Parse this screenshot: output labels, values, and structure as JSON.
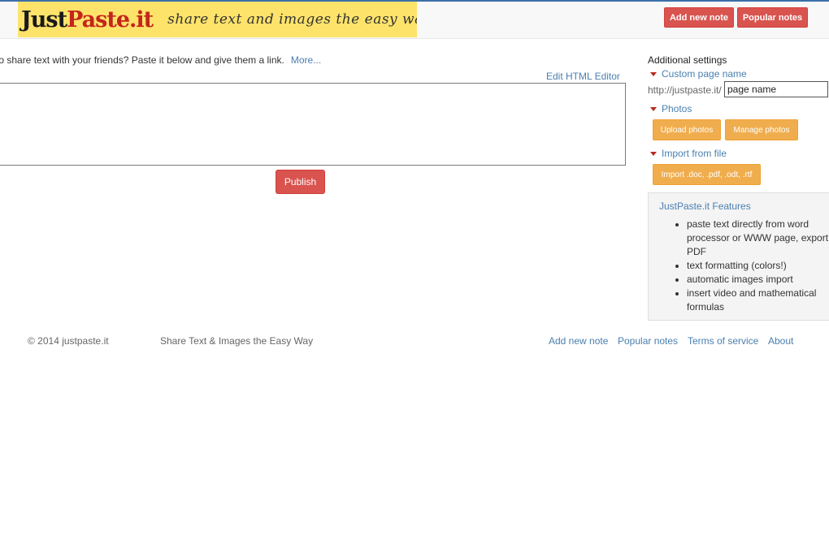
{
  "header": {
    "logo": {
      "word1": "Just",
      "word2": "Paste.it",
      "tagline": "share text and images the easy way"
    },
    "add_new_note": "Add new note",
    "popular_notes": "Popular notes"
  },
  "main": {
    "intro": "to share text with your friends? Paste it below and give them a link.",
    "more": "More...",
    "edit_html_editor": "Edit HTML Editor",
    "publish": "Publish"
  },
  "settings": {
    "title": "Additional settings",
    "custom_page_name": "Custom page name",
    "url_prefix": "http://justpaste.it/",
    "page_name_placeholder": "page name",
    "photos": "Photos",
    "upload_photos": "Upload photos",
    "manage_photos": "Manage photos",
    "import_from_file": "Import from file",
    "import_button": "Import .doc, .pdf, .odt, .rtf"
  },
  "features": {
    "title": "JustPaste.it Features",
    "items": [
      "paste text directly from word processor or WWW page, export PDF",
      "text formatting (colors!)",
      "automatic images import",
      "insert video and mathematical formulas"
    ]
  },
  "footer": {
    "copyright": "© 2014 justpaste.it",
    "tagline": "Share Text & Images the Easy Way",
    "links": [
      "Add new note",
      "Popular notes",
      "Terms of service",
      "About"
    ]
  },
  "colors": {
    "primary_red": "#d9534f",
    "orange": "#f0ad4e",
    "link_blue": "#4a7fb0",
    "logo_yellow": "#fde36a"
  },
  "icons": {
    "section_toggle": "caret-down-icon"
  }
}
